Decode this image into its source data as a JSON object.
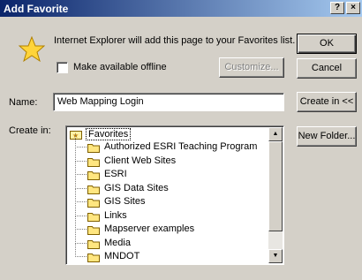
{
  "window": {
    "title": "Add Favorite",
    "help_label": "?",
    "close_label": "×"
  },
  "message": "Internet Explorer will add this page to your Favorites list.",
  "offline_checkbox": {
    "label": "Make available offline",
    "checked": false
  },
  "buttons": {
    "customize": "Customize...",
    "ok": "OK",
    "cancel": "Cancel",
    "create_in": "Create in <<",
    "new_folder": "New Folder..."
  },
  "name_field": {
    "label": "Name:",
    "value": "Web Mapping Login"
  },
  "create_in": {
    "label": "Create in:",
    "root": "Favorites",
    "folders": [
      "Authorized ESRI Teaching Program",
      "Client Web Sites",
      "ESRI",
      "GIS Data Sites",
      "GIS Sites",
      "Links",
      "Mapserver examples",
      "Media",
      "MNDOT"
    ]
  },
  "icons": {
    "favorites_star": "star-icon",
    "folder": "folder-icon"
  }
}
